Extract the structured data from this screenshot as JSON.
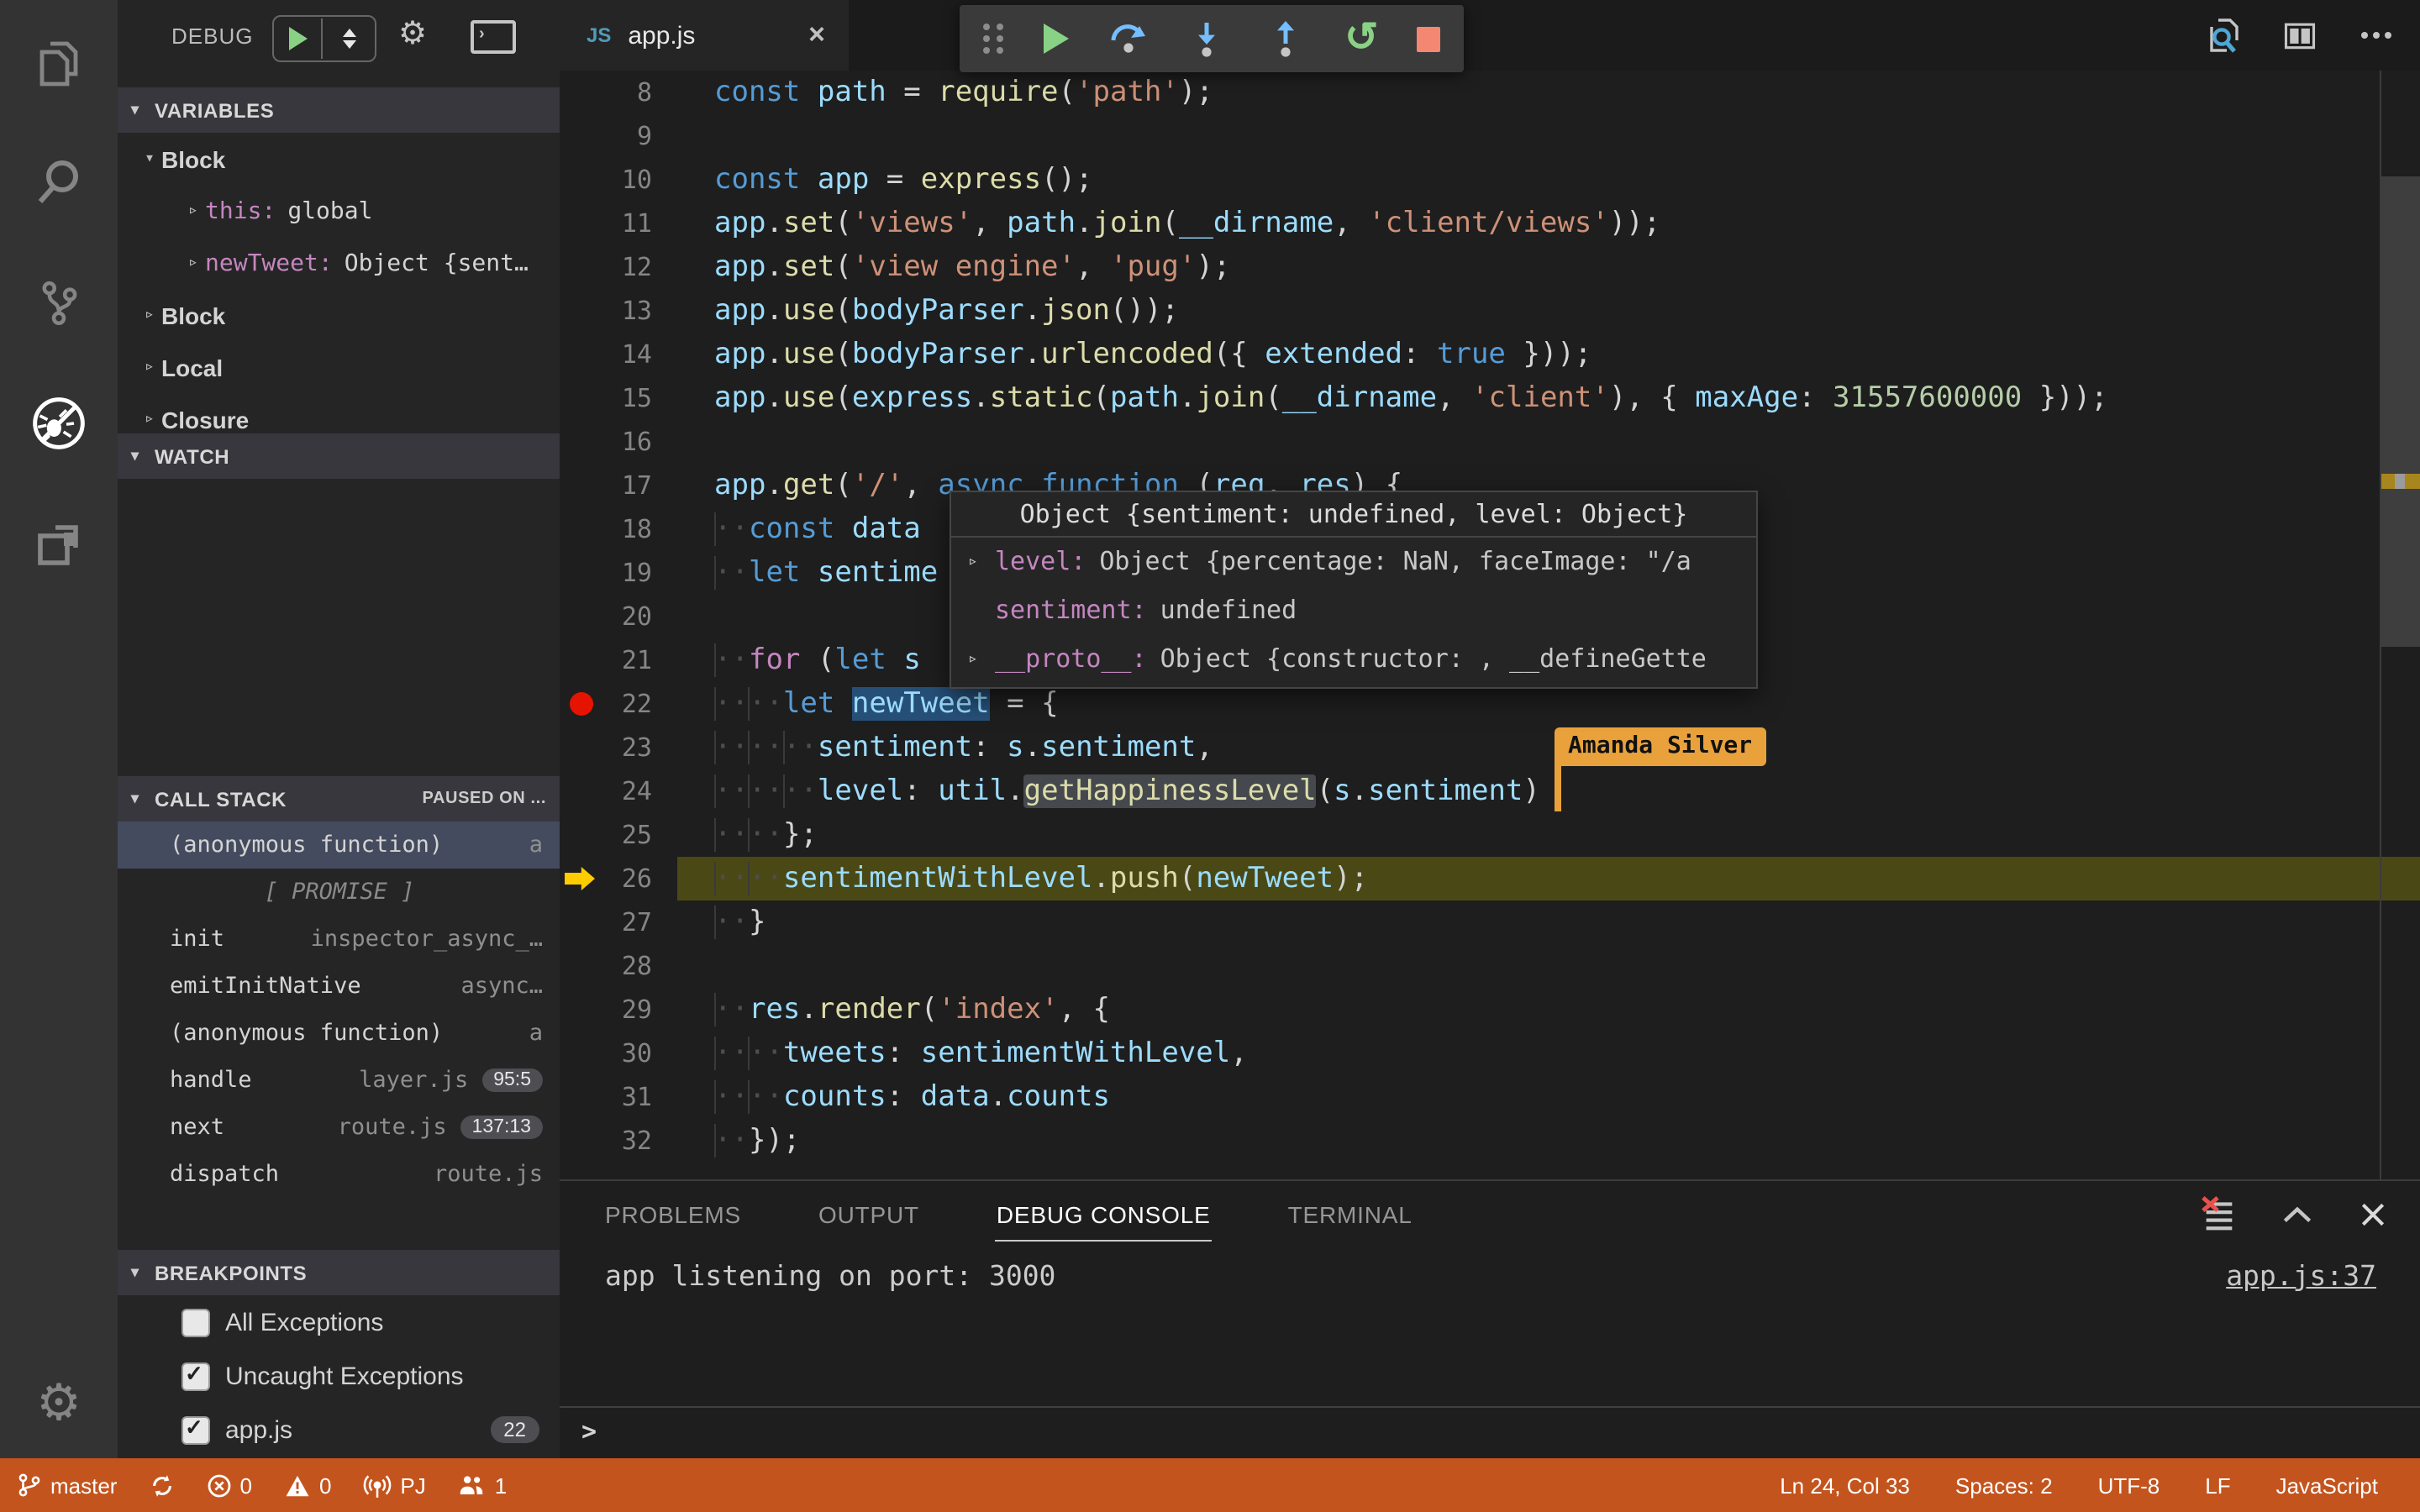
{
  "palette": {
    "status_debugging_bg": "#c4541d",
    "breakpoint_red": "#e51400",
    "current_line_olive": "#4a4915",
    "execution_arrow_yellow": "#ffcc00",
    "collab_orange": "#e9a23b",
    "debug_green": "#89d185",
    "step_blue": "#75beff",
    "stop_red": "#f48771",
    "selection_blue": "#264f78"
  },
  "activity_bar": {
    "items": [
      "files-explorer-icon",
      "search-icon",
      "source-control-icon",
      "debug-icon",
      "extensions-icon"
    ],
    "active_index": 3,
    "bottom_items": [
      "settings-gear-icon"
    ]
  },
  "sidebar": {
    "title": "DEBUG",
    "controls": [
      "debug-start-button",
      "launch-config-dropdown",
      "configure-gear-icon",
      "open-debug-console-icon"
    ],
    "sections": {
      "variables": "VARIABLES",
      "watch": "WATCH",
      "call_stack": "CALL STACK",
      "call_stack_badge": "PAUSED ON ...",
      "breakpoints": "BREAKPOINTS"
    },
    "variables": [
      {
        "kind": "scope",
        "state": "open",
        "label": "Block"
      },
      {
        "kind": "item",
        "state": "closed",
        "name": "this:",
        "value": "global"
      },
      {
        "kind": "item",
        "state": "closed",
        "name": "newTweet:",
        "value": "Object {sent…"
      },
      {
        "kind": "scope",
        "state": "closed",
        "label": "Block"
      },
      {
        "kind": "scope",
        "state": "closed",
        "label": "Local"
      },
      {
        "kind": "scope",
        "state": "closed",
        "label": "Closure"
      }
    ],
    "call_stack": [
      {
        "name": "(anonymous function)",
        "detail": "a",
        "selected": true
      },
      {
        "center": "[ PROMISE ]"
      },
      {
        "name": "init",
        "detail": "inspector_async_…"
      },
      {
        "name": "emitInitNative",
        "detail": "async…"
      },
      {
        "name": "(anonymous function)",
        "detail": "a"
      },
      {
        "name": "handle",
        "detail": "layer.js",
        "badge": "95:5"
      },
      {
        "name": "next",
        "detail": "route.js",
        "badge": "137:13"
      },
      {
        "name": "dispatch",
        "detail": "route.js"
      }
    ],
    "breakpoints": [
      {
        "checked": false,
        "label": "All Exceptions"
      },
      {
        "checked": true,
        "label": "Uncaught Exceptions"
      },
      {
        "checked": true,
        "label": "app.js",
        "badge": "22"
      }
    ]
  },
  "editor": {
    "tab": {
      "language_badge": "JS",
      "label": "app.js",
      "close_icon": "×"
    },
    "header_icons": [
      "search-editor-icon",
      "split-editor-icon",
      "more-actions-icon"
    ],
    "toolbar_icons": [
      "gripper-icon",
      "continue-icon",
      "step-over-icon",
      "step-into-icon",
      "step-out-icon",
      "restart-icon",
      "stop-icon"
    ],
    "collab_cursor": {
      "label": "Amanda Silver"
    },
    "hover": {
      "title": "Object {sentiment: undefined, level: Object}",
      "rows": [
        {
          "twisty": true,
          "name": "level:",
          "value": "Object {percentage: NaN, faceImage: \"/a"
        },
        {
          "twisty": false,
          "name": "sentiment:",
          "value": "undefined"
        },
        {
          "twisty": true,
          "name": "__proto__:",
          "value": "Object {constructor: , __defineGette"
        }
      ]
    },
    "lines": [
      {
        "n": 8,
        "t": [
          [
            "const",
            "kw"
          ],
          [
            " ",
            "pl"
          ],
          [
            "path",
            "var"
          ],
          [
            " = ",
            "pl"
          ],
          [
            "require",
            "fn"
          ],
          [
            "(",
            "pl"
          ],
          [
            "'path'",
            "str"
          ],
          [
            ");",
            "pl"
          ]
        ]
      },
      {
        "n": 9,
        "t": []
      },
      {
        "n": 10,
        "t": [
          [
            "const",
            "kw"
          ],
          [
            " ",
            "pl"
          ],
          [
            "app",
            "var"
          ],
          [
            " = ",
            "pl"
          ],
          [
            "express",
            "fn"
          ],
          [
            "();",
            "pl"
          ]
        ]
      },
      {
        "n": 11,
        "t": [
          [
            "app",
            "var"
          ],
          [
            ".",
            "pl"
          ],
          [
            "set",
            "fn"
          ],
          [
            "(",
            "pl"
          ],
          [
            "'views'",
            "str"
          ],
          [
            ", ",
            "pl"
          ],
          [
            "path",
            "var"
          ],
          [
            ".",
            "pl"
          ],
          [
            "join",
            "fn"
          ],
          [
            "(",
            "pl"
          ],
          [
            "__dirname",
            "var"
          ],
          [
            ", ",
            "pl"
          ],
          [
            "'client/views'",
            "str"
          ],
          [
            "));",
            "pl"
          ]
        ]
      },
      {
        "n": 12,
        "t": [
          [
            "app",
            "var"
          ],
          [
            ".",
            "pl"
          ],
          [
            "set",
            "fn"
          ],
          [
            "(",
            "pl"
          ],
          [
            "'view engine'",
            "str"
          ],
          [
            ", ",
            "pl"
          ],
          [
            "'pug'",
            "str"
          ],
          [
            ");",
            "pl"
          ]
        ]
      },
      {
        "n": 13,
        "t": [
          [
            "app",
            "var"
          ],
          [
            ".",
            "pl"
          ],
          [
            "use",
            "fn"
          ],
          [
            "(",
            "pl"
          ],
          [
            "bodyParser",
            "var"
          ],
          [
            ".",
            "pl"
          ],
          [
            "json",
            "fn"
          ],
          [
            "());",
            "pl"
          ]
        ]
      },
      {
        "n": 14,
        "t": [
          [
            "app",
            "var"
          ],
          [
            ".",
            "pl"
          ],
          [
            "use",
            "fn"
          ],
          [
            "(",
            "pl"
          ],
          [
            "bodyParser",
            "var"
          ],
          [
            ".",
            "pl"
          ],
          [
            "urlencoded",
            "fn"
          ],
          [
            "({ ",
            "pl"
          ],
          [
            "extended",
            "var"
          ],
          [
            ": ",
            "pl"
          ],
          [
            "true",
            "kw"
          ],
          [
            " }));",
            "pl"
          ]
        ]
      },
      {
        "n": 15,
        "t": [
          [
            "app",
            "var"
          ],
          [
            ".",
            "pl"
          ],
          [
            "use",
            "fn"
          ],
          [
            "(",
            "pl"
          ],
          [
            "express",
            "var"
          ],
          [
            ".",
            "pl"
          ],
          [
            "static",
            "fn"
          ],
          [
            "(",
            "pl"
          ],
          [
            "path",
            "var"
          ],
          [
            ".",
            "pl"
          ],
          [
            "join",
            "fn"
          ],
          [
            "(",
            "pl"
          ],
          [
            "__dirname",
            "var"
          ],
          [
            ", ",
            "pl"
          ],
          [
            "'client'",
            "str"
          ],
          [
            "), { ",
            "pl"
          ],
          [
            "maxAge",
            "var"
          ],
          [
            ": ",
            "pl"
          ],
          [
            "31557600000",
            "num"
          ],
          [
            " }));",
            "pl"
          ]
        ]
      },
      {
        "n": 16,
        "t": []
      },
      {
        "n": 17,
        "t": [
          [
            "app",
            "var"
          ],
          [
            ".",
            "pl"
          ],
          [
            "get",
            "fn"
          ],
          [
            "(",
            "pl"
          ],
          [
            "'/'",
            "str"
          ],
          [
            ", ",
            "pl"
          ],
          [
            "async",
            "kw"
          ],
          [
            " ",
            "pl"
          ],
          [
            "function",
            "kw"
          ],
          [
            " (",
            "pl"
          ],
          [
            "req",
            "var"
          ],
          [
            ", ",
            "pl"
          ],
          [
            "res",
            "var"
          ],
          [
            ") {",
            "pl"
          ]
        ]
      },
      {
        "n": 18,
        "t": [
          [
            "··",
            "ind"
          ],
          [
            "const",
            "kw"
          ],
          [
            " ",
            "pl"
          ],
          [
            "data",
            "var"
          ]
        ]
      },
      {
        "n": 19,
        "t": [
          [
            "··",
            "ind"
          ],
          [
            "let",
            "kw"
          ],
          [
            " ",
            "pl"
          ],
          [
            "sentime",
            "var"
          ]
        ]
      },
      {
        "n": 20,
        "t": []
      },
      {
        "n": 21,
        "t": [
          [
            "··",
            "ind"
          ],
          [
            "for",
            "ctl"
          ],
          [
            " (",
            "pl"
          ],
          [
            "let",
            "kw"
          ],
          [
            " ",
            "pl"
          ],
          [
            "s",
            "var"
          ]
        ]
      },
      {
        "n": 22,
        "bp": true,
        "t": [
          [
            "··",
            "ind"
          ],
          [
            "··",
            "ind"
          ],
          [
            "let",
            "kw"
          ],
          [
            " ",
            "pl"
          ],
          [
            "newTweet",
            "var sel"
          ],
          [
            " = {",
            "pl"
          ]
        ]
      },
      {
        "n": 23,
        "t": [
          [
            "··",
            "ind"
          ],
          [
            "··",
            "ind"
          ],
          [
            "··",
            "ind"
          ],
          [
            "sentiment",
            "var"
          ],
          [
            ": ",
            "pl"
          ],
          [
            "s",
            "var"
          ],
          [
            ".",
            "pl"
          ],
          [
            "sentiment",
            "var"
          ],
          [
            ",",
            "pl"
          ]
        ]
      },
      {
        "n": 24,
        "t": [
          [
            "··",
            "ind"
          ],
          [
            "··",
            "ind"
          ],
          [
            "··",
            "ind"
          ],
          [
            "level",
            "var"
          ],
          [
            ": ",
            "pl"
          ],
          [
            "util",
            "var"
          ],
          [
            ".",
            "pl"
          ],
          [
            "getHappinessLevel",
            "fn hl"
          ],
          [
            "(",
            "pl"
          ],
          [
            "s",
            "var"
          ],
          [
            ".",
            "pl"
          ],
          [
            "sentiment",
            "var"
          ],
          [
            ")",
            "pl"
          ]
        ]
      },
      {
        "n": 25,
        "t": [
          [
            "··",
            "ind"
          ],
          [
            "··",
            "ind"
          ],
          [
            "};",
            "pl"
          ]
        ]
      },
      {
        "n": 26,
        "cur": true,
        "t": [
          [
            "··",
            "ind"
          ],
          [
            "··",
            "ind"
          ],
          [
            "sentimentWithLevel",
            "var"
          ],
          [
            ".",
            "pl"
          ],
          [
            "push",
            "fn"
          ],
          [
            "(",
            "pl"
          ],
          [
            "newTweet",
            "var"
          ],
          [
            ");",
            "pl"
          ]
        ]
      },
      {
        "n": 27,
        "t": [
          [
            "··",
            "ind"
          ],
          [
            "}",
            "pl"
          ]
        ]
      },
      {
        "n": 28,
        "t": []
      },
      {
        "n": 29,
        "t": [
          [
            "··",
            "ind"
          ],
          [
            "res",
            "var"
          ],
          [
            ".",
            "pl"
          ],
          [
            "render",
            "fn"
          ],
          [
            "(",
            "pl"
          ],
          [
            "'index'",
            "str"
          ],
          [
            ", {",
            "pl"
          ]
        ]
      },
      {
        "n": 30,
        "t": [
          [
            "··",
            "ind"
          ],
          [
            "··",
            "ind"
          ],
          [
            "tweets",
            "var"
          ],
          [
            ": ",
            "pl"
          ],
          [
            "sentimentWithLevel",
            "var"
          ],
          [
            ",",
            "pl"
          ]
        ]
      },
      {
        "n": 31,
        "t": [
          [
            "··",
            "ind"
          ],
          [
            "··",
            "ind"
          ],
          [
            "counts",
            "var"
          ],
          [
            ": ",
            "pl"
          ],
          [
            "data",
            "var"
          ],
          [
            ".",
            "pl"
          ],
          [
            "counts",
            "var"
          ]
        ]
      },
      {
        "n": 32,
        "t": [
          [
            "··",
            "ind"
          ],
          [
            "});",
            "pl"
          ]
        ]
      }
    ]
  },
  "panel": {
    "tabs": [
      {
        "label": "PROBLEMS"
      },
      {
        "label": "OUTPUT"
      },
      {
        "label": "DEBUG CONSOLE",
        "active": true
      },
      {
        "label": "TERMINAL"
      }
    ],
    "icons": [
      "clear-console-icon",
      "maximize-panel-icon",
      "close-panel-icon"
    ],
    "console_line": "app listening on port: 3000",
    "source_link": "app.js:37",
    "prompt": ">"
  },
  "status_bar": {
    "left": [
      {
        "icon": "git-branch-icon",
        "label": "master"
      },
      {
        "icon": "sync-icon",
        "label": ""
      },
      {
        "icon": "error-icon",
        "label": "0"
      },
      {
        "icon": "warning-icon",
        "label": "0"
      },
      {
        "icon": "broadcast-icon",
        "label": "PJ"
      },
      {
        "icon": "people-icon",
        "label": "1"
      }
    ],
    "right": [
      {
        "label": "Ln 24, Col 33"
      },
      {
        "label": "Spaces: 2"
      },
      {
        "label": "UTF-8"
      },
      {
        "label": "LF"
      },
      {
        "label": "JavaScript"
      }
    ]
  }
}
